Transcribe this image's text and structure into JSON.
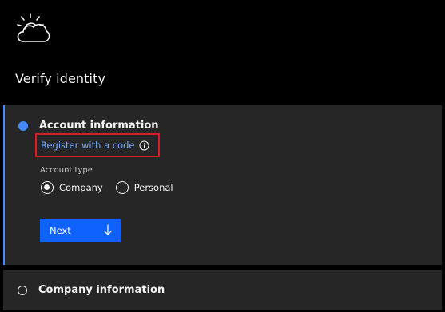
{
  "header": {
    "logo_icon": "cloud-sun-icon",
    "title": "Verify identity"
  },
  "steps": [
    {
      "title": "Account information",
      "state": "active",
      "register_link": "Register with a code",
      "register_link_icon": "info-icon",
      "field_label": "Account type",
      "radio_options": [
        {
          "label": "Company",
          "checked": true
        },
        {
          "label": "Personal",
          "checked": false
        }
      ],
      "next_button": "Next",
      "next_button_icon": "arrow-down-icon"
    },
    {
      "title": "Company information",
      "state": "incomplete"
    }
  ],
  "colors": {
    "background": "#000000",
    "panel": "#262626",
    "accent": "#4589ff",
    "link": "#78a9ff",
    "button": "#0f62fe",
    "highlight_box": "#da1e28"
  }
}
